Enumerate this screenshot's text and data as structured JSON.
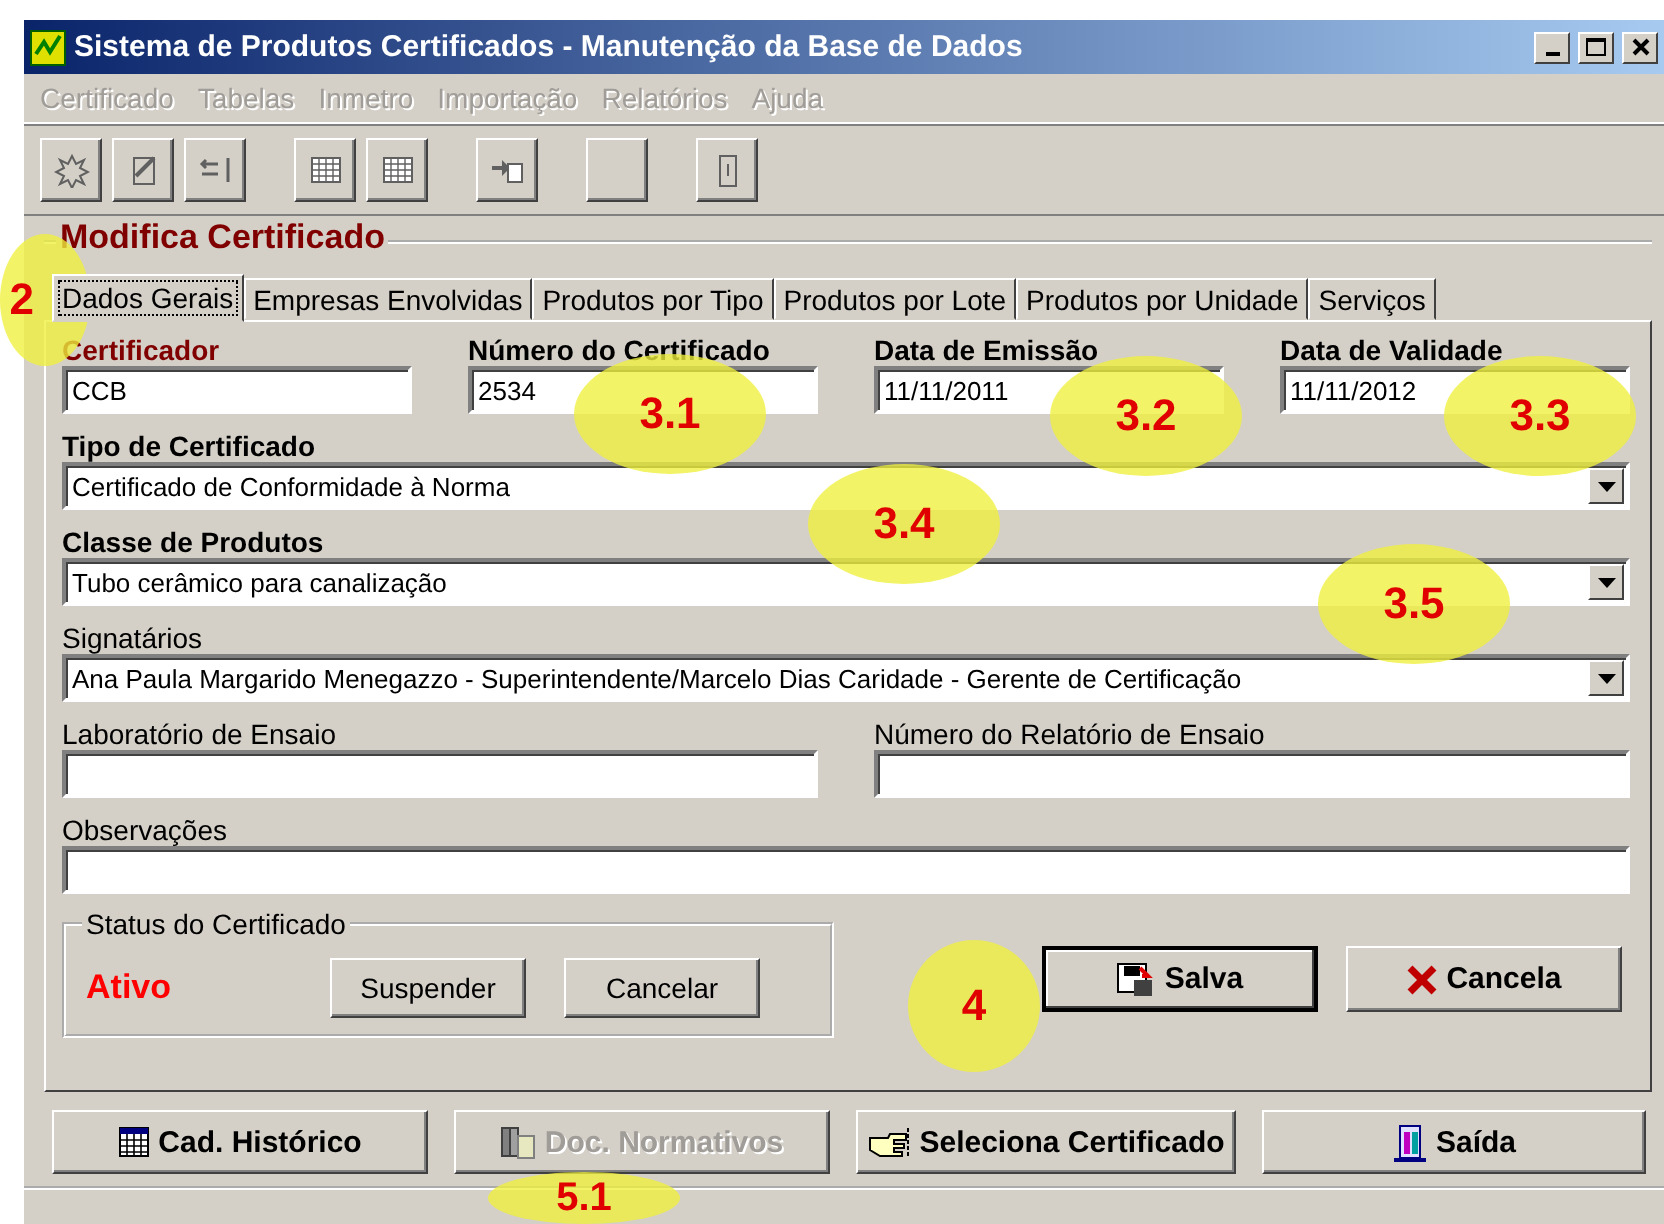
{
  "window": {
    "title": "Sistema de Produtos Certificados - Manutenção da Base de Dados"
  },
  "menu": [
    {
      "label": "Certificado",
      "disabled": true
    },
    {
      "label": "Tabelas",
      "disabled": true
    },
    {
      "label": "Inmetro",
      "disabled": true
    },
    {
      "label": "Importação",
      "disabled": true
    },
    {
      "label": "Relatórios",
      "disabled": true
    },
    {
      "label": "Ajuda",
      "disabled": true
    }
  ],
  "form_title": "Modifica Certificado",
  "tabs": [
    {
      "label": "Dados Gerais",
      "selected": true
    },
    {
      "label": "Empresas Envolvidas",
      "selected": false
    },
    {
      "label": "Produtos por Tipo",
      "selected": false
    },
    {
      "label": "Produtos por Lote",
      "selected": false
    },
    {
      "label": "Produtos por Unidade",
      "selected": false
    },
    {
      "label": "Serviços",
      "selected": false
    }
  ],
  "rows": [
    [
      {
        "kind": "text",
        "label": "Certificador",
        "bold": true,
        "key": true,
        "value": "CCB"
      },
      {
        "kind": "text",
        "label": "Número do Certificado",
        "bold": true,
        "key": false,
        "value": "2534"
      },
      {
        "kind": "text",
        "label": "Data de Emissão",
        "bold": true,
        "key": false,
        "value": "11/11/2011"
      },
      {
        "kind": "text",
        "label": "Data de Validade",
        "bold": true,
        "key": false,
        "value": "11/11/2012"
      }
    ],
    [
      {
        "kind": "combo",
        "label": "Tipo de Certificado",
        "bold": true,
        "key": false,
        "value": "Certificado de Conformidade à Norma"
      }
    ],
    [
      {
        "kind": "combo",
        "label": "Classe de Produtos",
        "bold": true,
        "key": false,
        "value": "Tubo cerâmico para canalização"
      }
    ],
    [
      {
        "kind": "combo",
        "label": "Signatários",
        "bold": false,
        "key": false,
        "value": "Ana Paula Margarido Menegazzo - Superintendente/Marcelo Dias Caridade - Gerente de Certificação"
      }
    ],
    [
      {
        "kind": "text",
        "label": "Laboratório de Ensaio",
        "bold": false,
        "key": false
      },
      {
        "kind": "text",
        "label": "Número do Relatório de Ensaio",
        "bold": false,
        "key": false
      }
    ],
    [
      {
        "kind": "text",
        "label": "Observações",
        "bold": false,
        "key": false
      }
    ]
  ],
  "status": {
    "title": "Status do Certificado",
    "value": "Ativo",
    "buttons": [
      "Suspender",
      "Cancelar"
    ]
  },
  "actions": [
    {
      "kind": "save",
      "label": "Salva"
    },
    {
      "kind": "cancel",
      "label": "Cancela"
    }
  ],
  "bottom_buttons": [
    {
      "kind": "history",
      "label": "Cad. Histórico",
      "disabled": false
    },
    {
      "kind": "docs",
      "label": "Doc. Normativos",
      "disabled": true
    },
    {
      "kind": "select",
      "label": "Seleciona Certificado",
      "disabled": false
    },
    {
      "kind": "exit",
      "label": "Saída",
      "disabled": false
    }
  ],
  "callouts": [
    "2",
    "3.1",
    "3.2",
    "3.3",
    "3.4",
    "3.5",
    "4",
    "5.1"
  ]
}
